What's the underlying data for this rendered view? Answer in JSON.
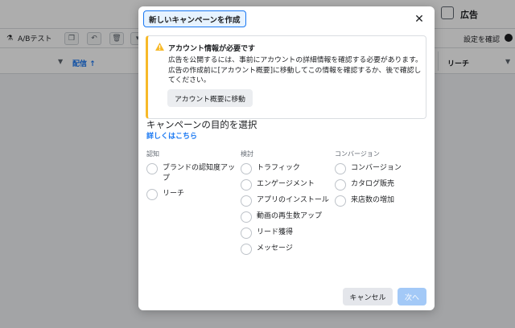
{
  "background": {
    "header_title": "広告",
    "toolbar": {
      "ab_test_label": "A/Bテスト",
      "confirm_settings_label": "設定を確認"
    },
    "table": {
      "delivery_header": "配信 ↑",
      "reach_header": "リーチ"
    }
  },
  "modal": {
    "title": "新しいキャンペーンを作成",
    "close_glyph": "✕",
    "alert": {
      "title": "アカウント情報が必要です",
      "body": "広告を公開するには、事前にアカウントの詳細情報を確認する必要があります。広告の作成前に[アカウント概要]に移動してこの情報を確認するか、後で確認してください。",
      "button_label": "アカウント概要に移動"
    },
    "objective_title": "キャンペーンの目的を選択",
    "learn_more": "詳しくはこちら",
    "columns": [
      {
        "heading": "認知",
        "options": [
          "ブランドの認知度アップ",
          "リーチ"
        ]
      },
      {
        "heading": "検討",
        "options": [
          "トラフィック",
          "エンゲージメント",
          "アプリのインストール",
          "動画の再生数アップ",
          "リード獲得",
          "メッセージ"
        ]
      },
      {
        "heading": "コンバージョン",
        "options": [
          "コンバージョン",
          "カタログ販売",
          "来店数の増加"
        ]
      }
    ],
    "cancel_label": "キャンセル",
    "next_label": "次へ"
  },
  "colors": {
    "accent": "#1877f2",
    "warning": "#f7b928",
    "next_disabled": "#a3c9f7"
  }
}
